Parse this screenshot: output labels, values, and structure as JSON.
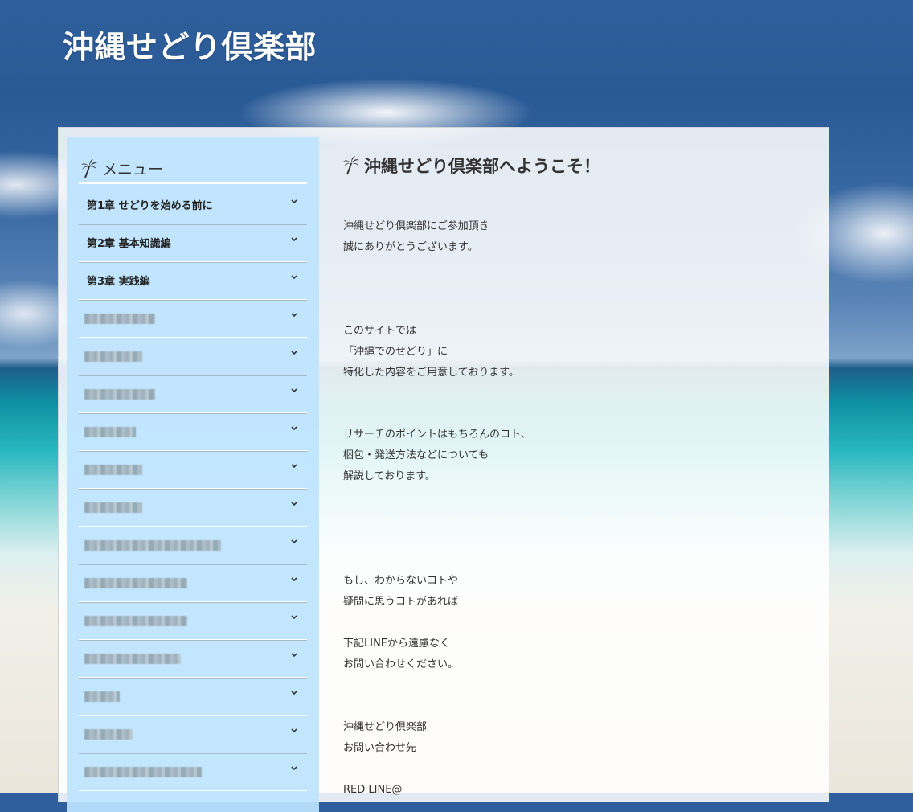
{
  "site": {
    "title": "沖縄せどり倶楽部"
  },
  "sidebar": {
    "menu_title": "メニュー",
    "items": [
      {
        "label": "第1章 せどりを始める前に",
        "blurred": false
      },
      {
        "label": "第2章 基本知識編",
        "blurred": false
      },
      {
        "label": "第3章 実践編",
        "blurred": false
      },
      {
        "label": "",
        "blurred": true
      },
      {
        "label": "",
        "blurred": true
      },
      {
        "label": "",
        "blurred": true
      },
      {
        "label": "",
        "blurred": true
      },
      {
        "label": "",
        "blurred": true
      },
      {
        "label": "",
        "blurred": true
      },
      {
        "label": "",
        "blurred": true
      },
      {
        "label": "",
        "blurred": true
      },
      {
        "label": "",
        "blurred": true
      },
      {
        "label": "",
        "blurred": true
      },
      {
        "label": "",
        "blurred": true
      },
      {
        "label": "",
        "blurred": true
      },
      {
        "label": "",
        "blurred": true
      }
    ]
  },
  "main": {
    "heading": "沖縄せどり倶楽部へようこそ！",
    "paragraphs": [
      [
        "沖縄せどり倶楽部にご参加頂き",
        "誠にありがとうございます。"
      ],
      [
        "このサイトでは",
        "「沖縄でのせどり」に",
        "特化した内容をご用意しております。"
      ],
      [
        "リサーチのポイントはもちろんのコト、",
        "梱包・発送方法などについても",
        "解説しております。"
      ],
      [
        "もし、わからないコトや",
        "疑問に思うコトがあれば"
      ],
      [
        "下記LINEから遠慮なく",
        "お問い合わせください。"
      ],
      [
        "沖縄せどり倶楽部",
        "お問い合わせ先"
      ],
      [
        "RED LINE@"
      ]
    ]
  },
  "colors": {
    "sidebar_bg": "#bee4ff",
    "title_text": "#ffffff",
    "body_text": "#333333"
  }
}
